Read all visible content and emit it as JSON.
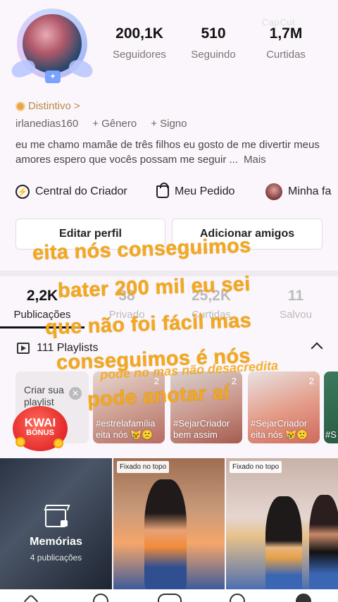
{
  "profile": {
    "stats": [
      {
        "value": "200,1K",
        "label": "Seguidores"
      },
      {
        "value": "510",
        "label": "Seguindo"
      },
      {
        "value": "1,7M",
        "label": "Curtidas"
      }
    ],
    "watermark": "CapCut",
    "badge_label": "Distintivo",
    "badge_chevron": ">",
    "username": "irlanedias160",
    "gender_label": "+ Gênero",
    "sign_label": "+ Signo",
    "bio": "eu me chamo mamãe de três filhos eu gosto de me divertir meus amores espero que vocês possam me seguir ...",
    "bio_more": "Mais"
  },
  "quick_actions": [
    {
      "label": "Central do Criador"
    },
    {
      "label": "Meu Pedido"
    },
    {
      "label": "Minha fa"
    }
  ],
  "buttons": {
    "edit_profile": "Editar perfil",
    "add_friends": "Adicionar amigos"
  },
  "tabs": [
    {
      "count": "2,2K",
      "label": "Publicações",
      "active": true
    },
    {
      "count": "38",
      "label": "Privado",
      "active": false
    },
    {
      "count": "25,2K",
      "label": "Curtidas",
      "active": false
    },
    {
      "count": "11",
      "label": "Salvou",
      "active": false
    }
  ],
  "playlists": {
    "title": "111 Playlists",
    "create_label": "Criar sua playlist",
    "items": [
      {
        "count": "2",
        "caption": "#estrelafamília eita nós 😿🙁"
      },
      {
        "count": "2",
        "caption": "#SejarCriador bem assim"
      },
      {
        "count": "2",
        "caption": "#SejarCriador eita nós 😿🙁"
      },
      {
        "count": "",
        "caption": "#S be"
      }
    ]
  },
  "kwai_bonus": {
    "line1": "KWAI",
    "line2": "BÔNUS"
  },
  "grid": {
    "memories_title": "Memórias",
    "memories_count": "4 publicações",
    "pinned_label": "Fixado no topo"
  },
  "overlay": {
    "lines": [
      "eita nós conseguimos",
      "bater 200 mil eu sei",
      "que não foi fácil mas",
      "conseguimos é nós",
      "pode anotar aí"
    ],
    "sticker_text": "pode no mas não desacredita"
  },
  "colors": {
    "overlay_text": "#f3a91e",
    "background": "#fbf6fb",
    "kwai_red": "#e42b2b"
  }
}
